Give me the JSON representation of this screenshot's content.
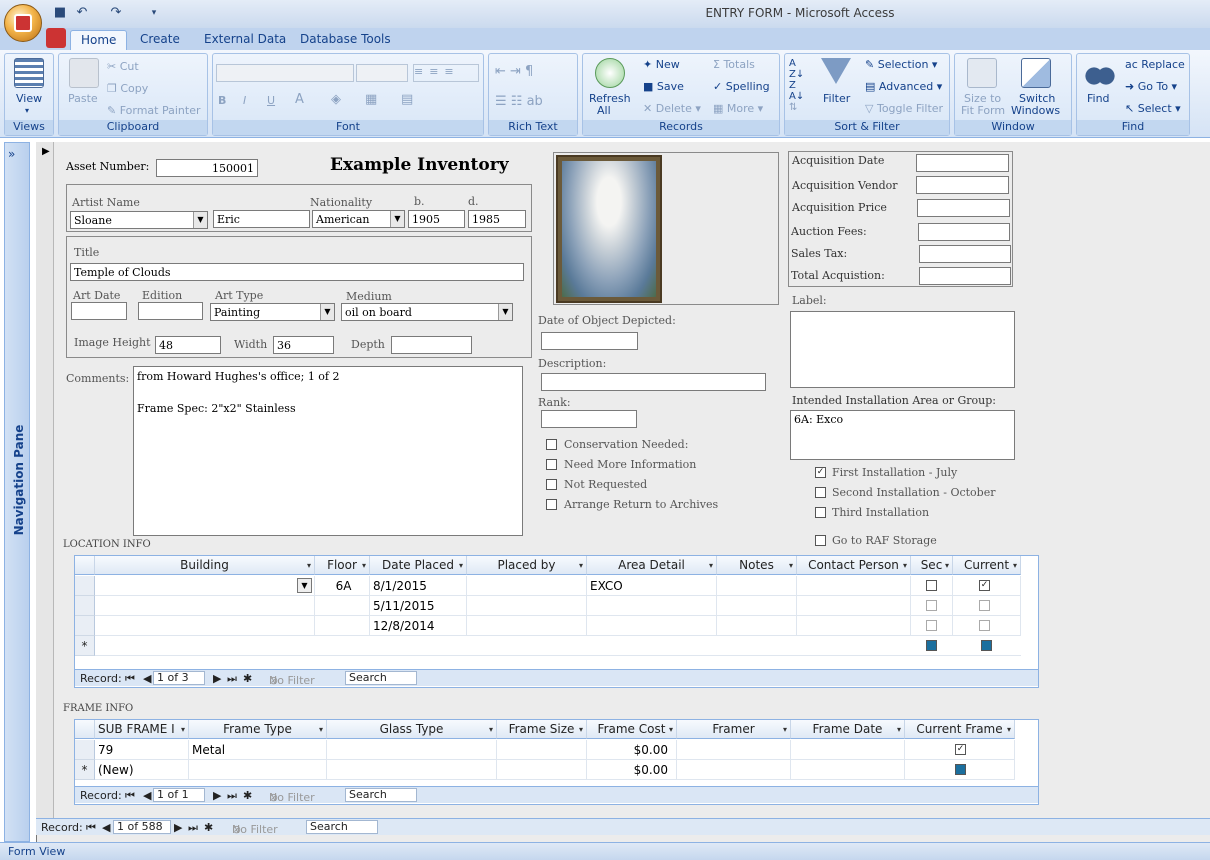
{
  "window": {
    "title": "ENTRY FORM - Microsoft Access"
  },
  "tabs": [
    "Home",
    "Create",
    "External Data",
    "Database Tools"
  ],
  "ribbon": {
    "views": {
      "view": "View",
      "group": "Views"
    },
    "clipboard": {
      "paste": "Paste",
      "cut": "Cut",
      "copy": "Copy",
      "format_painter": "Format Painter",
      "group": "Clipboard"
    },
    "font": {
      "group": "Font",
      "bold": "B",
      "italic": "I",
      "underline": "U"
    },
    "rich_text": {
      "group": "Rich Text"
    },
    "records": {
      "refresh": "Refresh",
      "all": "All",
      "new": "New",
      "save": "Save",
      "delete": "Delete",
      "totals": "Totals",
      "spelling": "Spelling",
      "more": "More",
      "group": "Records"
    },
    "sort_filter": {
      "filter": "Filter",
      "selection": "Selection",
      "advanced": "Advanced",
      "toggle_filter": "Toggle Filter",
      "group": "Sort & Filter"
    },
    "window": {
      "size_to": "Size to",
      "fit_form": "Fit Form",
      "switch": "Switch",
      "windows": "Windows",
      "group": "Window"
    },
    "find": {
      "find": "Find",
      "replace": "Replace",
      "go_to": "Go To",
      "select": "Select",
      "group": "Find"
    }
  },
  "nav_pane": {
    "label": "Navigation Pane",
    "toggle": "»"
  },
  "form": {
    "asset_label": "Asset Number:",
    "asset_value": "150001",
    "heading": "Example  Inventory",
    "artist_label": "Artist Name",
    "artist_last": "Sloane",
    "artist_first": "Eric",
    "nationality_label": "Nationality",
    "nationality": "American",
    "born_label": "b.",
    "born": "1905",
    "died_label": "d.",
    "died": "1985",
    "title_label": "Title",
    "title": "Temple of Clouds",
    "art_date_label": "Art Date",
    "edition_label": "Edition",
    "art_type_label": "Art Type",
    "art_type": "Painting",
    "medium_label": "Medium",
    "medium": "oil on board",
    "image_height_label": "Image Height",
    "image_height": "48",
    "width_label": "Width",
    "width": "36",
    "depth_label": "Depth",
    "comments_label": "Comments:",
    "comments_line1": "from Howard Hughes's office; 1 of 2",
    "comments_line2": "Frame Spec: 2\"x2\" Stainless",
    "date_depicted_label": "Date of Object Depicted:",
    "description_label": "Description:",
    "rank_label": "Rank:",
    "checks": [
      {
        "label": "Conservation Needed:",
        "checked": false
      },
      {
        "label": "Need More Information",
        "checked": false
      },
      {
        "label": "Not Requested",
        "checked": false
      },
      {
        "label": "Arrange Return to Archives",
        "checked": false
      }
    ],
    "acq": [
      {
        "label": "Acquisition Date"
      },
      {
        "label": "Acquisition Vendor"
      },
      {
        "label": "Acquisition Price"
      },
      {
        "label": "Auction Fees:"
      },
      {
        "label": "Sales Tax:"
      },
      {
        "label": "Total Acquistion:"
      }
    ],
    "label_label": "Label:",
    "install_label": "Intended Installation Area or Group:",
    "install_value": "6A: Exco",
    "install_checks": [
      {
        "label": "First Installation - July",
        "checked": true
      },
      {
        "label": "Second Installation - October",
        "checked": false
      },
      {
        "label": "Third Installation",
        "checked": false
      }
    ],
    "raf_label": "Go to RAF Storage",
    "check_mark": "✓"
  },
  "location": {
    "section": "LOCATION INFO",
    "headers": [
      "Building",
      "Floor",
      "Date Placed",
      "Placed by",
      "Area Detail",
      "Notes",
      "Contact Person",
      "Sec",
      "Current"
    ],
    "rows": [
      {
        "floor": "6A",
        "date": "8/1/2015",
        "area": "EXCO"
      },
      {
        "floor": "",
        "date": "5/11/2015",
        "area": ""
      },
      {
        "floor": "",
        "date": "12/8/2014",
        "area": ""
      }
    ],
    "new_marker": "*",
    "nav": {
      "record": "Record:",
      "position": "1 of 3",
      "nofilter": "No Filter",
      "search": "Search"
    }
  },
  "frame": {
    "section": "FRAME INFO",
    "headers": [
      "SUB FRAME I",
      "Frame Type",
      "Glass Type",
      "Frame Size",
      "Frame Cost",
      "Framer",
      "Frame Date",
      "Current Frame"
    ],
    "row": {
      "id": "79",
      "type": "Metal",
      "cost": "$0.00"
    },
    "new_row": {
      "id": "(New)",
      "cost": "$0.00"
    },
    "new_marker": "*",
    "nav": {
      "record": "Record:",
      "position": "1 of 1",
      "nofilter": "No Filter",
      "search": "Search"
    }
  },
  "main_nav": {
    "record": "Record:",
    "position": "1 of 588",
    "nofilter": "No Filter",
    "search": "Search"
  },
  "status": {
    "text": "Form View"
  }
}
